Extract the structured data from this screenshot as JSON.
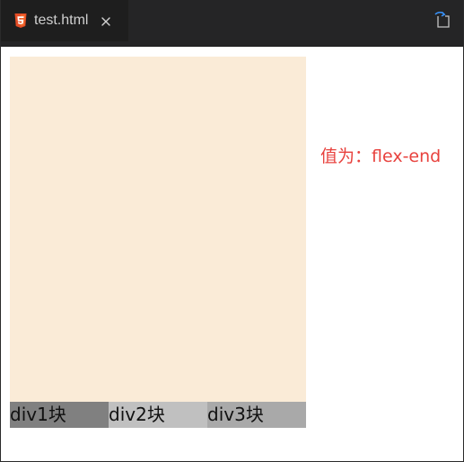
{
  "editor": {
    "tab": {
      "filename": "test.html",
      "file_icon": "html5-icon",
      "close_icon": "close-icon"
    },
    "actions": {
      "split_icon": "open-preview-icon"
    }
  },
  "preview": {
    "container_color": "#faebd7",
    "items": [
      {
        "label": "div1块",
        "color": "#808080"
      },
      {
        "label": "div2块",
        "color": "#c0c0c0"
      },
      {
        "label": "div3块",
        "color": "#a9a9a9"
      }
    ],
    "caption": "值为：flex-end",
    "caption_color": "#e8423e"
  }
}
